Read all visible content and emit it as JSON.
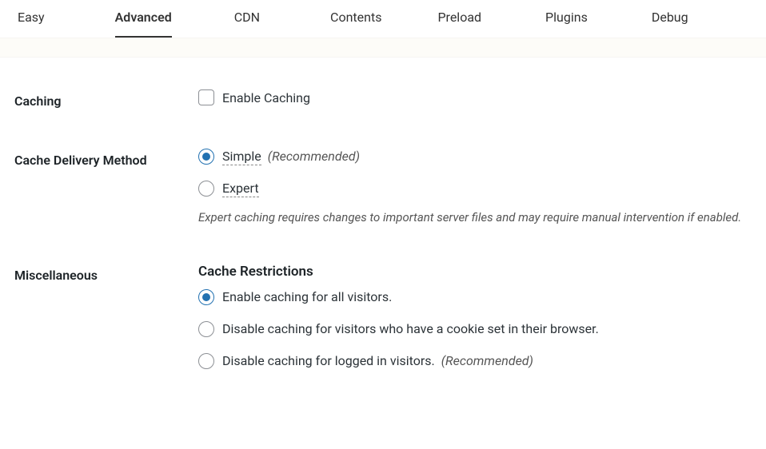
{
  "tabs": [
    {
      "label": "Easy"
    },
    {
      "label": "Advanced"
    },
    {
      "label": "CDN"
    },
    {
      "label": "Contents"
    },
    {
      "label": "Preload"
    },
    {
      "label": "Plugins"
    },
    {
      "label": "Debug"
    }
  ],
  "sections": {
    "caching": {
      "title": "Caching",
      "enable_label": "Enable Caching"
    },
    "delivery": {
      "title": "Cache Delivery Method",
      "simple": "Simple",
      "simple_hint": "(Recommended)",
      "expert": "Expert",
      "note": "Expert caching requires changes to important server files and may require manual intervention if enabled."
    },
    "misc": {
      "title": "Miscellaneous",
      "restrictions_title": "Cache Restrictions",
      "opt_all": "Enable caching for all visitors.",
      "opt_cookie": "Disable caching for visitors who have a cookie set in their browser.",
      "opt_logged_in": "Disable caching for logged in visitors.",
      "opt_logged_in_hint": "(Recommended)"
    }
  }
}
